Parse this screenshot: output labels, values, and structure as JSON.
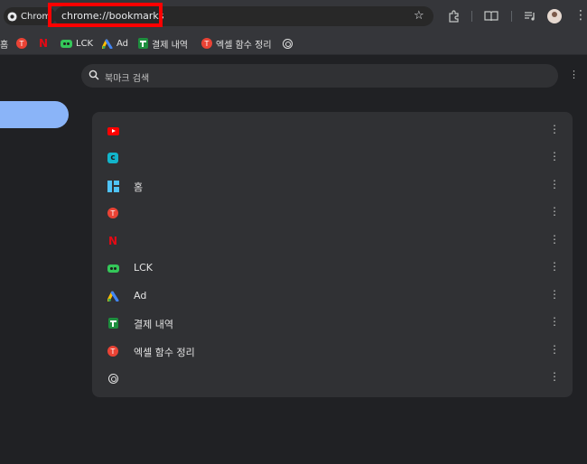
{
  "toolbar": {
    "site_chip_label": "Chrom",
    "url": "chrome://bookmarks"
  },
  "bookmarks_bar": {
    "items": [
      {
        "label": "홈",
        "icon": "home-icon"
      },
      {
        "label": "",
        "icon": "red-circle-icon"
      },
      {
        "label": "",
        "icon": "netflix-icon"
      },
      {
        "label": "LCK",
        "icon": "lck-icon"
      },
      {
        "label": "Ad",
        "icon": "google-ads-icon"
      },
      {
        "label": "결제 내역",
        "icon": "sheets-icon"
      },
      {
        "label": "엑셀 함수 정리",
        "icon": "red-circle-icon"
      },
      {
        "label": "",
        "icon": "globe-icon"
      }
    ]
  },
  "search": {
    "placeholder": "북마크 검색"
  },
  "bookmark_list": [
    {
      "label": "",
      "icon": "youtube-icon"
    },
    {
      "label": "",
      "icon": "teal-app-icon"
    },
    {
      "label": "홈",
      "icon": "dashboard-icon"
    },
    {
      "label": "",
      "icon": "red-circle-icon"
    },
    {
      "label": "",
      "icon": "netflix-icon"
    },
    {
      "label": "LCK",
      "icon": "lck-icon"
    },
    {
      "label": "Ad",
      "icon": "google-ads-icon"
    },
    {
      "label": "결제 내역",
      "icon": "sheets-icon"
    },
    {
      "label": "엑셀 함수 정리",
      "icon": "red-circle-icon"
    },
    {
      "label": "",
      "icon": "globe-icon"
    }
  ],
  "colors": {
    "accent": "#8ab4f8",
    "highlight": "#ff0000",
    "background": "#202124",
    "card": "#303134"
  }
}
